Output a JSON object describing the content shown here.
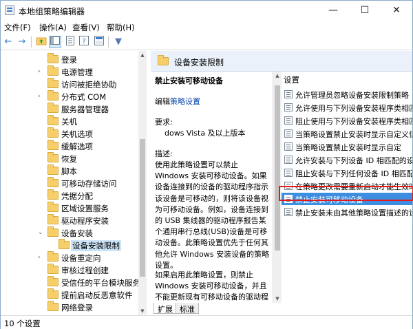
{
  "window": {
    "title": "本地组策略编辑器"
  },
  "window_buttons": {
    "minimize": "—",
    "maximize": "☐",
    "close": "✕"
  },
  "menu": [
    "文件(F)",
    "操作(A)",
    "查看(V)",
    "帮助(H)"
  ],
  "toolbar_icons": [
    "back-arrow-icon",
    "forward-arrow-icon",
    "folder-up-icon",
    "show-hide-tree-icon",
    "properties-icon",
    "help-icon",
    "console-tree-icon",
    "filter-icon"
  ],
  "toolbar_glyphs": {
    "back": "←",
    "forward": "→",
    "filter": "▼"
  },
  "tree": [
    {
      "label": "登录",
      "expander": ""
    },
    {
      "label": "电源管理",
      "expander": "›"
    },
    {
      "label": "访问被拒绝协助",
      "expander": ""
    },
    {
      "label": "分布式 COM",
      "expander": "›"
    },
    {
      "label": "服务器管理器",
      "expander": ""
    },
    {
      "label": "关机",
      "expander": ""
    },
    {
      "label": "关机选项",
      "expander": ""
    },
    {
      "label": "缓解选项",
      "expander": ""
    },
    {
      "label": "恢复",
      "expander": ""
    },
    {
      "label": "脚本",
      "expander": ""
    },
    {
      "label": "可移动存储访问",
      "expander": ""
    },
    {
      "label": "凭据分配",
      "expander": ""
    },
    {
      "label": "区域设置服务",
      "expander": ""
    },
    {
      "label": "驱动程序安装",
      "expander": ""
    },
    {
      "label": "设备安装",
      "expander": "⌄"
    },
    {
      "label": "设备安装限制",
      "expander": "",
      "selected": true,
      "child": true
    },
    {
      "label": "设备重定向",
      "expander": "›"
    },
    {
      "label": "审核过程创建",
      "expander": ""
    },
    {
      "label": "受信任的平台模块服务",
      "expander": ""
    },
    {
      "label": "提前启动反恶意软件",
      "expander": ""
    },
    {
      "label": "网络登录",
      "expander": ""
    }
  ],
  "detail": {
    "header": "设备安装限制",
    "policy_title": "禁止安装可移动设备",
    "edit_prefix": "编辑",
    "edit_link": "策略设置",
    "requirements_label": "要求:",
    "requirements_value": "dows Vista 及以上版本",
    "description_label": "描述:",
    "description": "使用此策略设置可以禁止 Windows 安装可移动设备。如果设备连接到的设备的驱动程序指示该设备是可移动的，则将该设备视为可移动设备。例如，设备连接到的 USB 集线器的驱动程序报告某个通用串行总线(USB)设备是可移动设备。此策略设置优先于任何其他允许 Windows 安装设备的策略设置。",
    "description2": "如果启用此策略设置，则禁止 Windows 安装可移动设备，并且不能更新现有可移动设备的驱动程"
  },
  "settings": {
    "header": "设置",
    "items": [
      "允许管理员忽略设备安装限制策略",
      "允许使用与下列设备安装程序类相匹",
      "阻止使用与下列设备安装程序类相匹",
      "当策略设置禁止安装时显示自定义信",
      "当策略设置禁止安装时显示自定",
      "允许安装与下列设备 ID 相匹配的设",
      "阻止安装与下列任何设备 ID 相匹配的",
      "在策略更改需要重新启动才能生效时",
      "禁止安装可移动设备",
      "禁止安装未由其他策略设置描述的设"
    ],
    "selected_index": 8
  },
  "tabs": [
    "扩展",
    "标准"
  ],
  "status": "10 个设置",
  "colors": {
    "selection": "#3d8ee0",
    "highlight_box": "#e81818",
    "tree_selection": "#cce4f7"
  }
}
